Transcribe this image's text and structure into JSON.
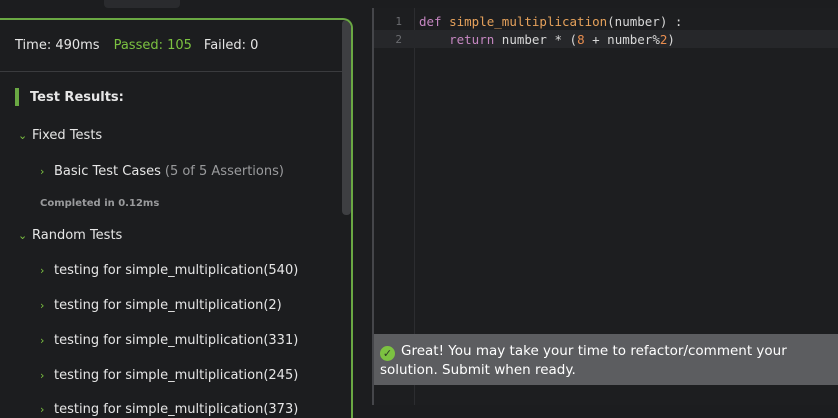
{
  "stats": {
    "time": "Time: 490ms",
    "passed": "Passed: 105",
    "failed": "Failed: 0"
  },
  "results": {
    "title": "Test Results:",
    "fixed_group": "Fixed Tests",
    "basic_case": "Basic Test Cases",
    "basic_assertions": "(5 of 5 Assertions)",
    "completed": "Completed in 0.12ms",
    "random_group": "Random Tests",
    "random_items": [
      "testing for simple_multiplication(540)",
      "testing for simple_multiplication(2)",
      "testing for simple_multiplication(331)",
      "testing for simple_multiplication(245)",
      "testing for simple_multiplication(373)"
    ]
  },
  "editor": {
    "line_numbers": [
      "1",
      "2"
    ],
    "line1": {
      "kw": "def",
      "fn": "simple_multiplication",
      "rest": "(number) :"
    },
    "line2": {
      "kw": "return",
      "a": " number * (",
      "n1": "8",
      "b": " + number%",
      "n2": "2",
      "c": ")"
    }
  },
  "toast": {
    "icon": "check-circle-icon",
    "message": "Great! You may take your time to refactor/comment your solution. Submit when ready."
  },
  "colors": {
    "accent": "#6aa843",
    "passed": "#7cc241"
  }
}
